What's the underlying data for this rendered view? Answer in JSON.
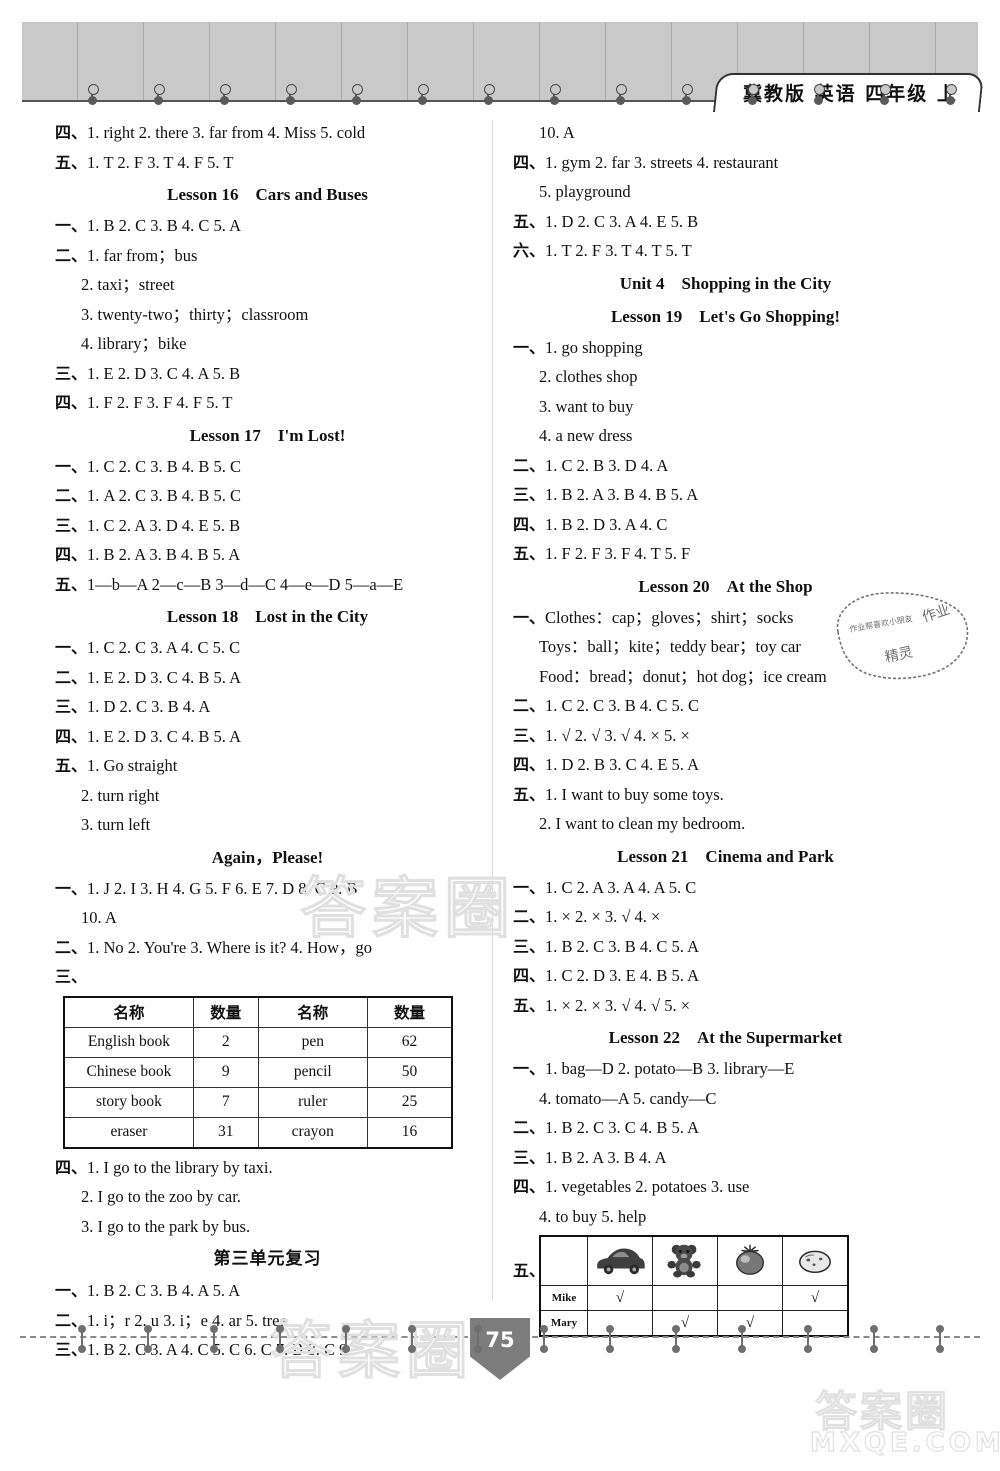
{
  "header": {
    "tab_text": "冀教版  英语  四年级 上"
  },
  "page": {
    "number": "75"
  },
  "watermarks": {
    "middle": "答案圈",
    "bottom": "答案圈",
    "logo_cn": "答案圈",
    "logo_url": "MXQE.COM",
    "stamp_line1": "作业",
    "stamp_line2": "作业帮喜欢小朋友",
    "stamp_line3": "精灵"
  },
  "left_column": {
    "blocks": [
      {
        "type": "line",
        "text": "四、1. right   2. there   3. far from   4. Miss   5. cold"
      },
      {
        "type": "line",
        "text": "五、1. T   2. F   3. T   4. F   5. T"
      },
      {
        "type": "title",
        "text": "Lesson 16　Cars and Buses"
      },
      {
        "type": "line",
        "text": "一、1. B   2. C   3. B   4. C   5. A"
      },
      {
        "type": "line",
        "text": "二、1. far from；bus"
      },
      {
        "type": "line_ind",
        "text": "2. taxi；street"
      },
      {
        "type": "line_ind",
        "text": "3. twenty-two；thirty；classroom"
      },
      {
        "type": "line_ind",
        "text": "4. library；bike"
      },
      {
        "type": "line",
        "text": "三、1. E   2. D   3. C   4. A   5. B"
      },
      {
        "type": "line",
        "text": "四、1. F   2. F   3. F   4. F   5. T"
      },
      {
        "type": "title",
        "text": "Lesson 17　I'm Lost!"
      },
      {
        "type": "line",
        "text": "一、1. C   2. C   3. B   4. B   5. C"
      },
      {
        "type": "line",
        "text": "二、1. A   2. C   3. B   4. B   5. C"
      },
      {
        "type": "line",
        "text": "三、1. C   2. A   3. D   4. E   5. B"
      },
      {
        "type": "line",
        "text": "四、1. B   2. A   3. B   4. B   5. A"
      },
      {
        "type": "line",
        "text": "五、1—b—A   2—c—B   3—d—C   4—e—D   5—a—E"
      },
      {
        "type": "title",
        "text": "Lesson 18　Lost in the City"
      },
      {
        "type": "line",
        "text": "一、1. C   2. C   3. A   4. C   5. C"
      },
      {
        "type": "line",
        "text": "二、1. E   2. D   3. C   4. B   5. A"
      },
      {
        "type": "line",
        "text": "三、1. D   2. C   3. B   4. A"
      },
      {
        "type": "line",
        "text": "四、1. E   2. D   3. C   4. B   5. A"
      },
      {
        "type": "line",
        "text": "五、1. Go straight"
      },
      {
        "type": "line_ind",
        "text": "2. turn right"
      },
      {
        "type": "line_ind",
        "text": "3. turn left"
      },
      {
        "type": "title",
        "text": "Again，Please!"
      },
      {
        "type": "line",
        "text": "一、1. J   2. I   3. H   4. G   5. F   6. E   7. D   8. C   9. B"
      },
      {
        "type": "line_ind",
        "text": "10. A"
      },
      {
        "type": "line",
        "text": "二、1. No   2. You're   3. Where is it?     4. How，go"
      },
      {
        "type": "line",
        "text": "三、"
      },
      {
        "type": "table"
      },
      {
        "type": "line",
        "text": "四、1. I go to the library by taxi."
      },
      {
        "type": "line_ind",
        "text": "2. I go to the zoo by car."
      },
      {
        "type": "line_ind",
        "text": "3. I go to the park by bus."
      },
      {
        "type": "title_cn",
        "text": "第三单元复习"
      },
      {
        "type": "line",
        "text": "一、1. B   2. C   3. B   4. A   5. A"
      },
      {
        "type": "line",
        "text": "二、1. i；r   2. u   3. i；e   4. ar   5. tree"
      },
      {
        "type": "line",
        "text": "三、1. B   2. C   3. A   4. C   5. C   6. C   7. B   8. C   9."
      }
    ],
    "word_table": {
      "headers": [
        "名称",
        "数量",
        "名称",
        "数量"
      ],
      "rows": [
        [
          "English book",
          "2",
          "pen",
          "62"
        ],
        [
          "Chinese book",
          "9",
          "pencil",
          "50"
        ],
        [
          "story book",
          "7",
          "ruler",
          "25"
        ],
        [
          "eraser",
          "31",
          "crayon",
          "16"
        ]
      ]
    }
  },
  "right_column": {
    "blocks": [
      {
        "type": "line_ind",
        "text": "10. A"
      },
      {
        "type": "line",
        "text": "四、1. gym   2. far   3. streets   4. restaurant"
      },
      {
        "type": "line_ind",
        "text": "5. playground"
      },
      {
        "type": "line",
        "text": "五、1. D   2. C   3. A   4. E   5. B"
      },
      {
        "type": "line",
        "text": "六、1. T   2. F   3. T   4. T   5. T"
      },
      {
        "type": "title",
        "text": "Unit 4　Shopping in the City"
      },
      {
        "type": "title",
        "text": "Lesson 19　Let's Go Shopping!"
      },
      {
        "type": "line",
        "text": "一、1. go shopping"
      },
      {
        "type": "line_ind",
        "text": "2. clothes shop"
      },
      {
        "type": "line_ind",
        "text": "3. want to buy"
      },
      {
        "type": "line_ind",
        "text": "4. a new dress"
      },
      {
        "type": "line",
        "text": "二、1. C   2. B   3. D   4. A"
      },
      {
        "type": "line",
        "text": "三、1. B   2. A   3. B   4. B   5. A"
      },
      {
        "type": "line",
        "text": "四、1. B   2. D   3. A   4. C"
      },
      {
        "type": "line",
        "text": "五、1. F   2. F   3. F   4. T   5. F"
      },
      {
        "type": "title",
        "text": "Lesson 20　At the Shop"
      },
      {
        "type": "line",
        "text": "一、Clothes：cap；gloves；shirt；socks"
      },
      {
        "type": "line_ind",
        "text": "Toys：ball；kite；teddy bear；toy car"
      },
      {
        "type": "line_ind",
        "text": "Food：bread；donut；hot dog；ice cream"
      },
      {
        "type": "line",
        "text": "二、1. C   2. C   3. B   4. C   5. C"
      },
      {
        "type": "line",
        "text": "三、1. √   2. √   3. √   4. ×   5. ×"
      },
      {
        "type": "line",
        "text": "四、1. D   2. B   3. C   4. E   5. A"
      },
      {
        "type": "line",
        "text": "五、1. I want to buy some toys."
      },
      {
        "type": "line_ind",
        "text": "2. I want to clean my bedroom."
      },
      {
        "type": "title",
        "text": "Lesson 21　Cinema and Park"
      },
      {
        "type": "line",
        "text": "一、1. C   2. A   3. A   4. A   5. C"
      },
      {
        "type": "line",
        "text": "二、1. ×   2. ×   3. √   4. ×"
      },
      {
        "type": "line",
        "text": "三、1. B   2. C   3. B   4. C   5. A"
      },
      {
        "type": "line",
        "text": "四、1. C   2. D   3. E   4. B   5. A"
      },
      {
        "type": "line",
        "text": "五、1. ×   2. ×   3. √   4. √   5. ×"
      },
      {
        "type": "title",
        "text": "Lesson 22　At the Supermarket"
      },
      {
        "type": "line",
        "text": "一、1. bag—D   2. potato—B   3. library—E"
      },
      {
        "type": "line_ind",
        "text": "4. tomato—A   5. candy—C"
      },
      {
        "type": "line",
        "text": "二、1. B   2. C   3. C   4. B   5. A"
      },
      {
        "type": "line",
        "text": "三、1. B   2. A   3. B   4. A"
      },
      {
        "type": "line",
        "text": "四、1. vegetables   2. potatoes   3. use"
      },
      {
        "type": "line_ind",
        "text": "4. to buy   5. help"
      },
      {
        "type": "pictable"
      }
    ],
    "picture_table": {
      "lead": "五、",
      "columns": [
        "toy-car",
        "teddy-bear",
        "tomato",
        "potato"
      ],
      "rows": [
        {
          "name": "Mike",
          "marks": [
            "√",
            "",
            "",
            "√"
          ]
        },
        {
          "name": "Mary",
          "marks": [
            "",
            "√",
            "√",
            ""
          ]
        }
      ]
    }
  }
}
